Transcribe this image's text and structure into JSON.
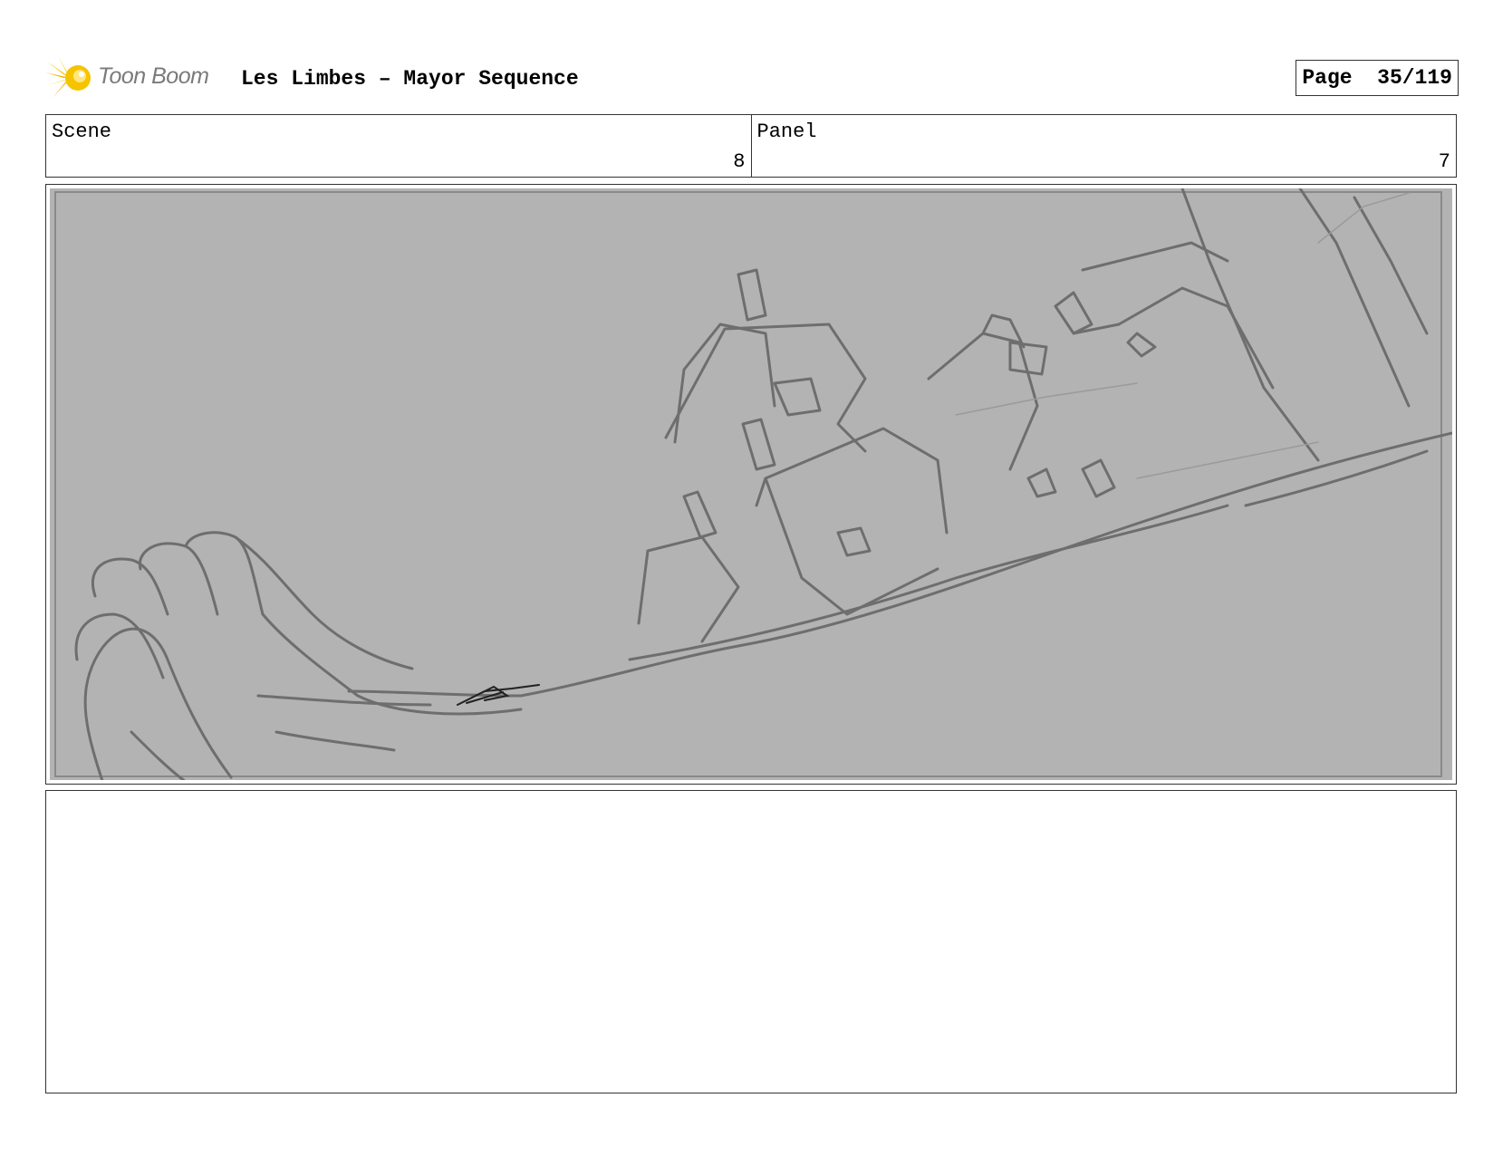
{
  "header": {
    "brand": "Toon Boom",
    "title": "Les Limbes – Mayor Sequence",
    "page_label": "Page",
    "page_number": "35/119",
    "logo_icon": "toon-boom-starburst-logo",
    "accent_color": "#f5c400"
  },
  "info": {
    "scene_label": "Scene",
    "scene_value": "8",
    "panel_label": "Panel",
    "panel_value": "7"
  },
  "panel": {
    "background_color": "#b3b3b3",
    "sketch_color": "#6e6e6e"
  },
  "notes": {
    "text": ""
  }
}
